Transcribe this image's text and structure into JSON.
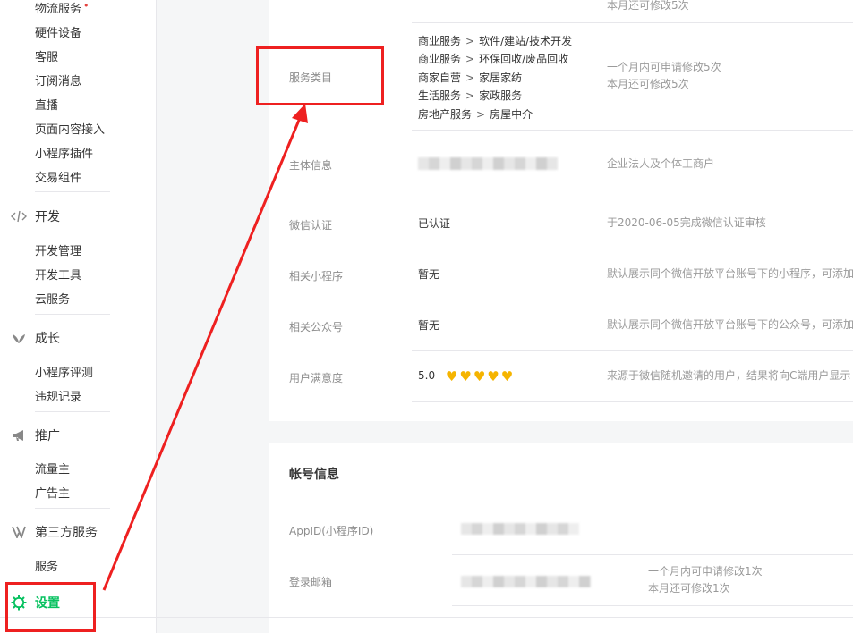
{
  "sidebar": {
    "top_items": [
      "物流服务",
      "硬件设备",
      "客服",
      "订阅消息",
      "直播",
      "页面内容接入",
      "小程序插件",
      "交易组件"
    ],
    "groups": [
      {
        "label": "开发",
        "icon": "code-icon",
        "items": [
          "开发管理",
          "开发工具",
          "云服务"
        ]
      },
      {
        "label": "成长",
        "icon": "leaf-icon",
        "items": [
          "小程序评测",
          "违规记录"
        ]
      },
      {
        "label": "推广",
        "icon": "megaphone-icon",
        "items": [
          "流量主",
          "广告主"
        ]
      },
      {
        "label": "第三方服务",
        "icon": "third-party-icon",
        "items": [
          "服务"
        ]
      }
    ],
    "settings_label": "设置",
    "accent_color": "#07c160"
  },
  "basic_info": {
    "top_partial": {
      "desc": "本月还可修改5次"
    },
    "service_category": {
      "label": "服务类目",
      "items": [
        [
          "商业服务",
          "软件/建站/技术开发"
        ],
        [
          "商业服务",
          "环保回收/废品回收"
        ],
        [
          "商家自营",
          "家居家纺"
        ],
        [
          "生活服务",
          "家政服务"
        ],
        [
          "房地产服务",
          "房屋中介"
        ]
      ],
      "separator": ">",
      "desc_line1": "一个月内可申请修改5次",
      "desc_line2": "本月还可修改5次"
    },
    "subject": {
      "label": "主体信息",
      "desc": "企业法人及个体工商户"
    },
    "wechat_cert": {
      "label": "微信认证",
      "value": "已认证",
      "desc": "于2020-06-05完成微信认证审核"
    },
    "related_miniprogram": {
      "label": "相关小程序",
      "value": "暂无",
      "desc": "默认展示同个微信开放平台账号下的小程序，可添加"
    },
    "related_official": {
      "label": "相关公众号",
      "value": "暂无",
      "desc": "默认展示同个微信开放平台账号下的公众号，可添加"
    },
    "satisfaction": {
      "label": "用户满意度",
      "value": "5.0",
      "stars": 5,
      "desc": "来源于微信随机邀请的用户，结果将向C端用户显示"
    }
  },
  "account_info": {
    "title": "帐号信息",
    "appid_label": "AppID(小程序ID)",
    "email_label": "登录邮箱",
    "email_desc_line1": "一个月内可申请修改1次",
    "email_desc_line2": "本月还可修改1次"
  },
  "annotation_color": "#ee2020"
}
